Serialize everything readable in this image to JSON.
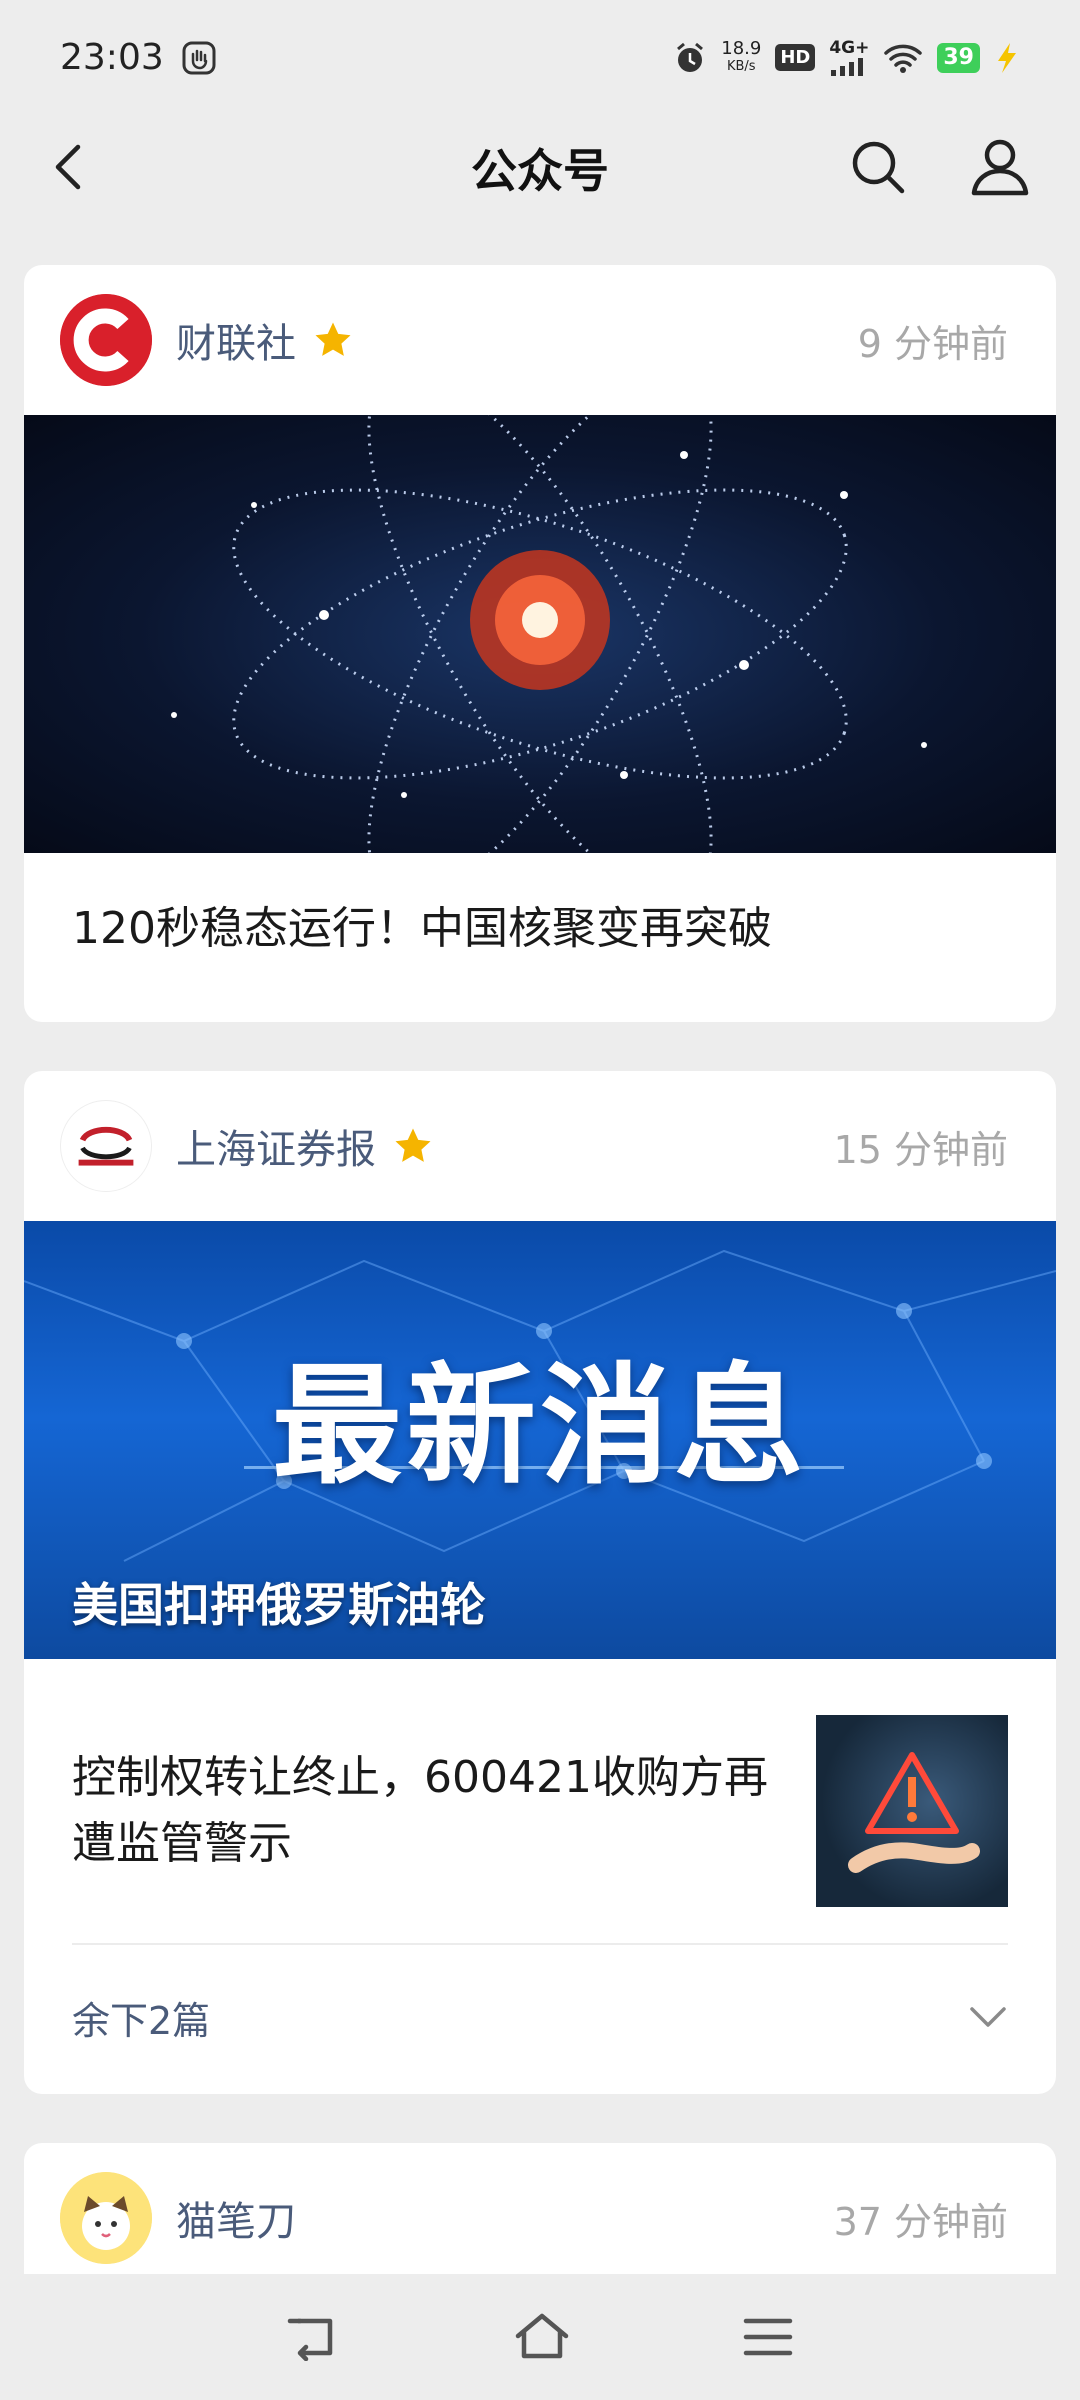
{
  "status": {
    "time": "23:03",
    "net_speed_top": "18.9",
    "net_speed_bottom": "KB/s",
    "hd": "HD",
    "signal": "4G+",
    "battery": "39"
  },
  "header": {
    "title": "公众号"
  },
  "cards": [
    {
      "account": "财联社",
      "starred": true,
      "time_ago": "9 分钟前",
      "headline": "120秒稳态运行！中国核聚变再突破"
    },
    {
      "account": "上海证券报",
      "starred": true,
      "time_ago": "15 分钟前",
      "banner_text": "最新消息",
      "banner_caption": "美国扣押俄罗斯油轮",
      "sub_article": "控制权转让终止，600421收购方再遭监管警示",
      "more_label": "余下2篇"
    },
    {
      "account": "猫笔刀",
      "starred": false,
      "time_ago": "37 分钟前"
    }
  ],
  "colors": {
    "accent_star": "#f5b400",
    "account_text": "#4a5b7a",
    "cailianshe_red": "#d9202b"
  }
}
